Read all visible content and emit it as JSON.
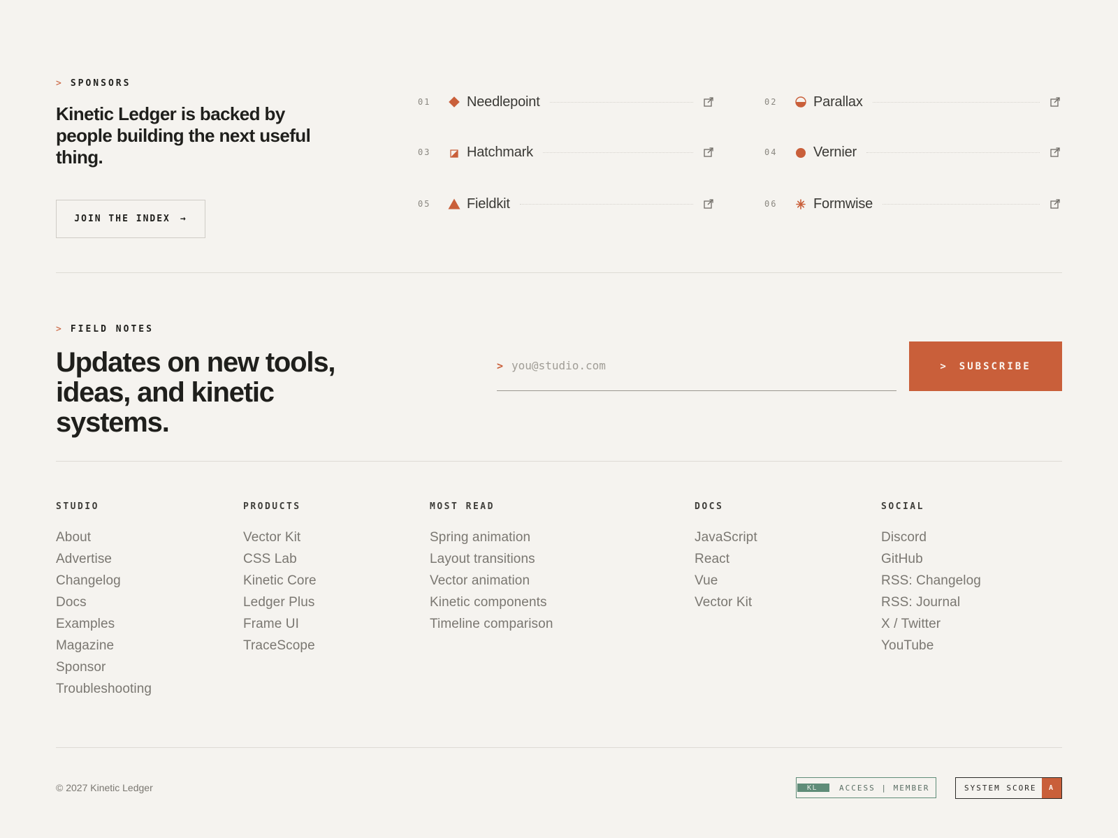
{
  "sponsors": {
    "label_caret": ">",
    "label": "SPONSORS",
    "heading": "Kinetic Ledger is backed by people building the next useful thing.",
    "cta_label": "JOIN THE INDEX",
    "cta_arrow": "→",
    "items": [
      {
        "num": "01",
        "name": "Needlepoint",
        "logo": "diamond-icon"
      },
      {
        "num": "02",
        "name": "Parallax",
        "logo": "half-circle-icon"
      },
      {
        "num": "03",
        "name": "Hatchmark",
        "logo": "hatched-square-icon"
      },
      {
        "num": "04",
        "name": "Vernier",
        "logo": "circle-icon"
      },
      {
        "num": "05",
        "name": "Fieldkit",
        "logo": "triangle-icon"
      },
      {
        "num": "06",
        "name": "Formwise",
        "logo": "asterisk-icon"
      }
    ]
  },
  "field_notes": {
    "label_caret": ">",
    "label": "FIELD NOTES",
    "heading": "Updates on new tools, ideas, and kinetic systems.",
    "email_prompt": ">",
    "email_placeholder": "you@studio.com",
    "subscribe_caret": ">",
    "subscribe_label": "SUBSCRIBE"
  },
  "footer": {
    "columns": [
      {
        "title": "STUDIO",
        "links": [
          "About",
          "Advertise",
          "Changelog",
          "Docs",
          "Examples",
          "Magazine",
          "Sponsor",
          "Troubleshooting"
        ]
      },
      {
        "title": "PRODUCTS",
        "links": [
          "Vector Kit",
          "CSS Lab",
          "Kinetic Core",
          "Ledger Plus",
          "Frame UI",
          "TraceScope"
        ]
      },
      {
        "title": "MOST READ",
        "links": [
          "Spring animation",
          "Layout transitions",
          "Vector animation",
          "Kinetic components",
          "Timeline comparison"
        ]
      },
      {
        "title": "DOCS",
        "links": [
          "JavaScript",
          "React",
          "Vue",
          "Vector Kit"
        ]
      },
      {
        "title": "SOCIAL",
        "links": [
          "Discord",
          "GitHub",
          "RSS: Changelog",
          "RSS: Journal",
          "X / Twitter",
          "YouTube"
        ]
      }
    ],
    "copyright": "© 2027 Kinetic Ledger",
    "access_badge": {
      "kl": "KL",
      "text": "ACCESS | MEMBER"
    },
    "score_badge": {
      "label": "SYSTEM SCORE",
      "grade": "A"
    }
  },
  "colors": {
    "background": "#f5f3ef",
    "accent": "#c95f3a",
    "badge_green": "#5f8c78",
    "text": "#1f1f1c",
    "muted": "#7a7771"
  }
}
